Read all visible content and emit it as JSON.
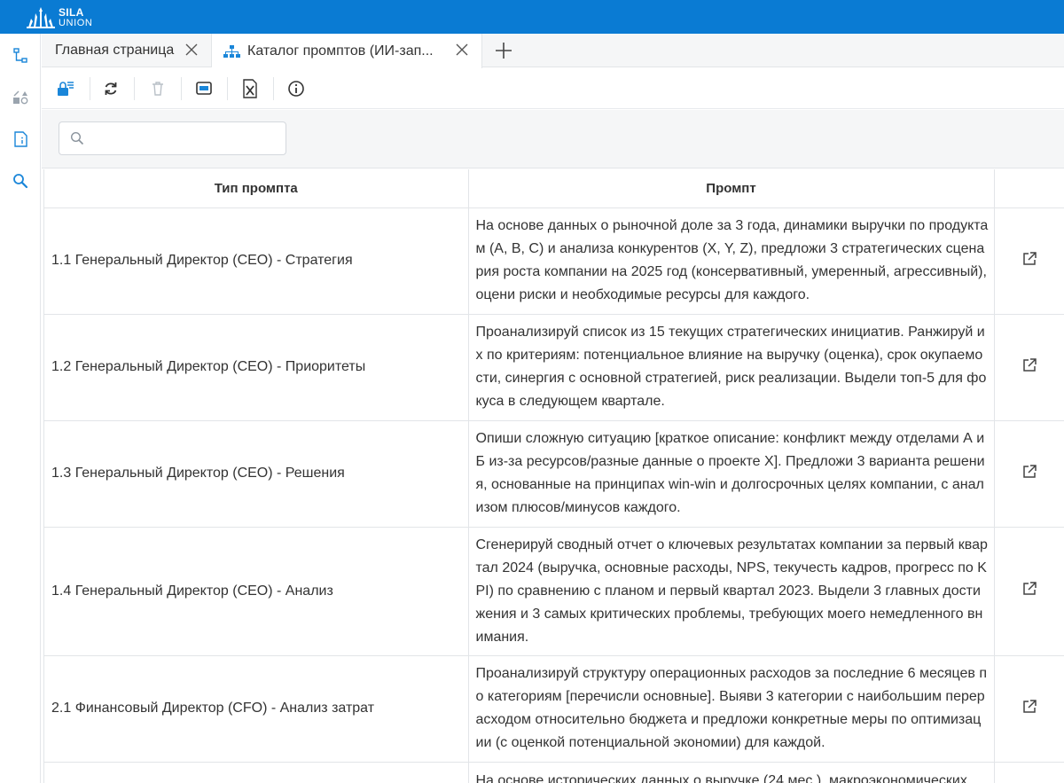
{
  "app": {
    "logo_line1": "SILA",
    "logo_line2": "UNION",
    "brand_color": "#0a7bd3"
  },
  "nav": {
    "items": [
      {
        "icon": "tree-icon"
      },
      {
        "icon": "shapes-icon"
      },
      {
        "icon": "document-icon"
      },
      {
        "icon": "search-icon"
      }
    ]
  },
  "tabs": [
    {
      "label": "Главная страница",
      "icon": null
    },
    {
      "label": "Каталог промптов (ИИ-зап...",
      "icon": "hierarchy-icon"
    }
  ],
  "toolbar": {
    "buttons": [
      "add-record-icon",
      "refresh-icon",
      "delete-icon",
      "view-icon",
      "excel-export-icon",
      "info-icon"
    ]
  },
  "search": {
    "value": "",
    "placeholder": ""
  },
  "table": {
    "headers": [
      "Тип промпта",
      "Промпт",
      ""
    ],
    "rows": [
      {
        "type": "1.1 Генеральный Директор (CEO) - Стратегия",
        "prompt": "На основе данных о рыночной доле за 3 года, динамики выручки по продуктам (A, B, C) и анализа конкурентов (X, Y, Z), предложи 3 стратегических сценария роста компании на 2025 год (консервативный, умеренный, агрессивный), оцени риски и необходимые ресурсы для каждого."
      },
      {
        "type": "1.2 Генеральный Директор (CEO) - Приоритеты",
        "prompt": "Проанализируй список из 15 текущих стратегических инициатив. Ранжируй их по критериям: потенциальное влияние на выручку (оценка), срок окупаемости, синергия с основной стратегией, риск реализации. Выдели топ-5 для фокуса в следующем квартале."
      },
      {
        "type": "1.3 Генеральный Директор (CEO) - Решения",
        "prompt": "Опиши сложную ситуацию [краткое описание: конфликт между отделами А и Б из-за ресурсов/разные данные о проекте X]. Предложи 3 варианта решения, основанные на принципах win-win и долгосрочных целях компании, с анализом плюсов/минусов каждого."
      },
      {
        "type": "1.4 Генеральный Директор (CEO) - Анализ",
        "prompt": "Сгенерируй сводный отчет о ключевых результатах компании за первый квартал 2024 (выручка, основные расходы, NPS, текучесть кадров, прогресс по KPI) по сравнению с планом и первый квартал 2023. Выдели 3 главных достижения и 3 самых критических проблемы, требующих моего немедленного внимания."
      },
      {
        "type": "2.1 Финансовый Директор (CFO) - Анализ затрат",
        "prompt": "Проанализируй структуру операционных расходов за последние 6 месяцев по категориям [перечисли основные]. Выяви 3 категории с наибольшим перерасходом относительно бюджета и предложи конкретные меры по оптимизации (с оценкой потенциальной экономии) для каждой."
      },
      {
        "type": "",
        "prompt": "На основе исторических данных о выручке (24 мес.), макроэкономических"
      }
    ]
  }
}
